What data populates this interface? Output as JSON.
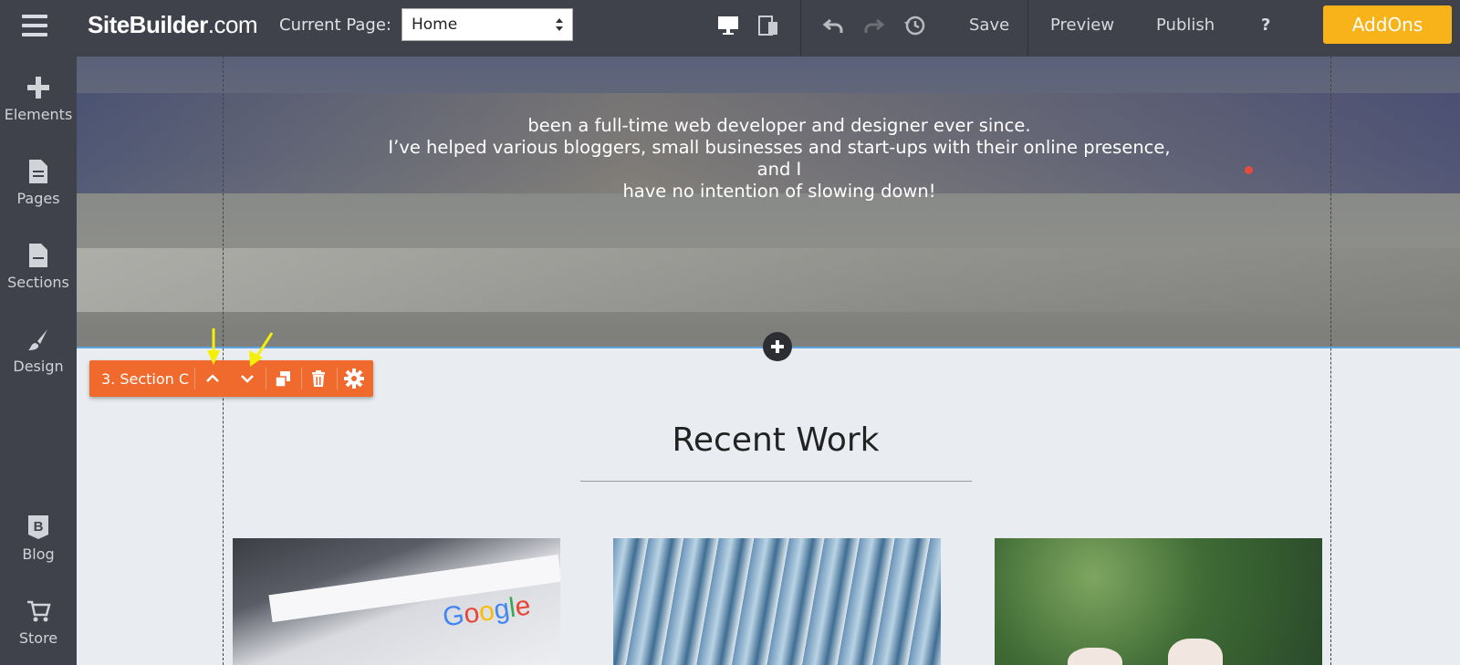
{
  "topbar": {
    "brand_main": "SiteBuilder",
    "brand_suffix": ".com",
    "current_page_label": "Current Page:",
    "current_page_value": "Home",
    "save_label": "Save",
    "preview_label": "Preview",
    "publish_label": "Publish",
    "help_label": "?",
    "addons_label": "AddOns"
  },
  "sidebar": {
    "items": [
      {
        "label": "Elements",
        "icon": "plus-icon"
      },
      {
        "label": "Pages",
        "icon": "page-icon"
      },
      {
        "label": "Sections",
        "icon": "sections-icon"
      },
      {
        "label": "Design",
        "icon": "brush-icon"
      },
      {
        "label": "Blog",
        "icon": "blog-icon"
      },
      {
        "label": "Store",
        "icon": "cart-icon"
      }
    ]
  },
  "hero": {
    "line1": "been a full-time web developer and designer ever since.",
    "line2": "I’ve helped various bloggers, small businesses and start-ups with their online presence, and I",
    "line3": "have no intention of slowing down!"
  },
  "section_toolbar": {
    "label": "3. Section C"
  },
  "recent_work": {
    "title": "Recent Work",
    "image1_text": "Google"
  },
  "colors": {
    "topbar_bg": "#3f424b",
    "accent_orange": "#ef6a2c",
    "addons_yellow": "#f8b31a",
    "section_line_blue": "#5ea6e0"
  }
}
